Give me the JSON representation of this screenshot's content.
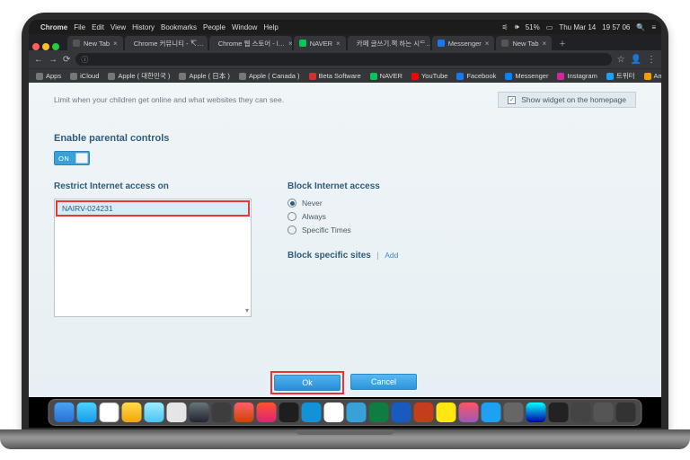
{
  "menubar": {
    "apple": "",
    "app": "Chrome",
    "items": [
      "File",
      "Edit",
      "View",
      "History",
      "Bookmarks",
      "People",
      "Window",
      "Help"
    ],
    "right": {
      "battery": "51%",
      "date": "Thu Mar 14",
      "time": "19 57 06"
    }
  },
  "tabs": [
    {
      "label": "New Tab"
    },
    {
      "label": "Chrome 커뮤니티 - ↸…"
    },
    {
      "label": "Chrome 웹 스토어 - l…"
    },
    {
      "label": "NAVER"
    },
    {
      "label": "카페 글쓰기.책 하는 시ᄃ…"
    },
    {
      "label": "Messenger"
    },
    {
      "label": "New Tab"
    }
  ],
  "bookmarks": [
    "Apps",
    "iCloud",
    "Apple ( 대한민국 )",
    "Apple ( 日本 )",
    "Apple ( Canada )",
    "Beta Software",
    "NAVER",
    "YouTube",
    "Facebook",
    "Messenger",
    "Instagram",
    "트위터",
    "Amazon"
  ],
  "page": {
    "limit_desc": "Limit when your children get online and what websites they can see.",
    "show_widget": "Show widget on the homepage",
    "enable_heading": "Enable parental controls",
    "toggle": "ON",
    "restrict_heading": "Restrict Internet access on",
    "device": "NAIRV-024231",
    "block_heading": "Block Internet access",
    "radios": {
      "never": "Never",
      "always": "Always",
      "specific": "Specific Times"
    },
    "block_sites": "Block specific sites",
    "add": "Add",
    "ok": "Ok",
    "cancel": "Cancel"
  }
}
